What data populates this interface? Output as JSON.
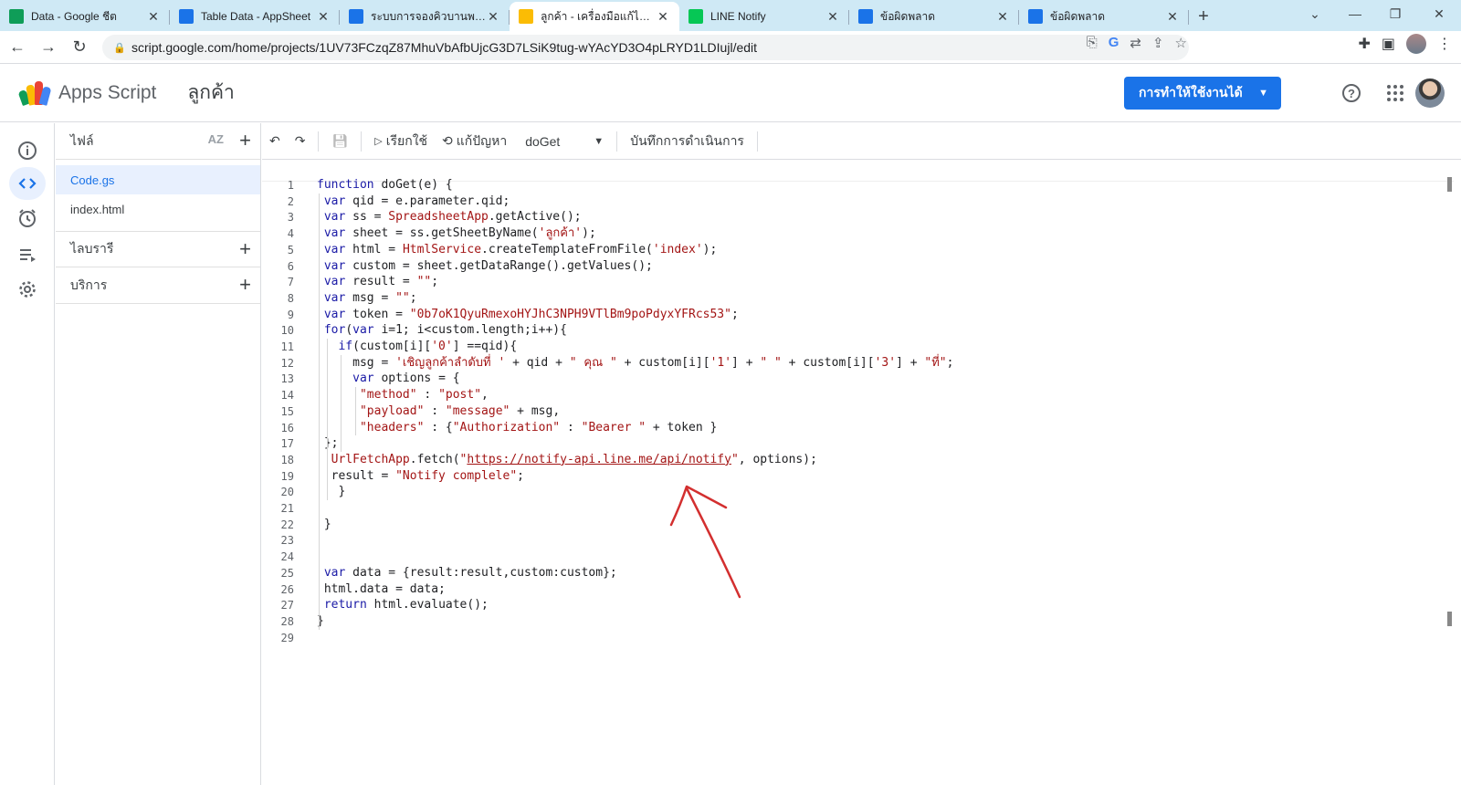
{
  "browser": {
    "tabs": [
      {
        "label": "Data - Google ชีต",
        "icon": "sheets-icon",
        "color": "#0f9d58",
        "active": false
      },
      {
        "label": "Table Data - AppSheet",
        "icon": "appsheet-icon",
        "color": "#1a73e8",
        "active": false
      },
      {
        "label": "ระบบการจองคิวบานพาหนะ",
        "icon": "appsheet-icon",
        "color": "#1a73e8",
        "active": false
      },
      {
        "label": "ลูกค้า - เครื่องมือแก้ไขโครงการ",
        "icon": "apps-script-icon",
        "color": "#fbbc04",
        "active": true
      },
      {
        "label": "LINE Notify",
        "icon": "line-icon",
        "color": "#06c755",
        "active": false
      },
      {
        "label": "ข้อผิดพลาด",
        "icon": "arrow-icon",
        "color": "#1a73e8",
        "active": false
      },
      {
        "label": "ข้อผิดพลาด",
        "icon": "arrow-icon",
        "color": "#1a73e8",
        "active": false
      }
    ],
    "url": "script.google.com/home/projects/1UV73FCzqZ87MhuVbAfbUjcG3D7LSiK9tug-wYAcYD3O4pLRYD1LDIujl/edit"
  },
  "app": {
    "name": "Apps Script",
    "project_title": "ลูกค้า",
    "deploy_label": "การทำให้ใช้งานได้"
  },
  "files_panel": {
    "files_header": "ไฟล์",
    "sort_label": "AZ",
    "files": [
      "Code.gs",
      "index.html"
    ],
    "libraries_header": "ไลบรารี",
    "services_header": "บริการ"
  },
  "editor_toolbar": {
    "run_label": "เรียกใช้",
    "debug_label": "แก้ปัญหา",
    "function_name": "doGet",
    "log_label": "บันทึกการดำเนินการ"
  },
  "code": {
    "line_numbers": [
      "1",
      "2",
      "3",
      "4",
      "5",
      "6",
      "7",
      "8",
      "9",
      "10",
      "11",
      "12",
      "13",
      "14",
      "15",
      "16",
      "17",
      "18",
      "19",
      "20",
      "21",
      "22",
      "23",
      "24",
      "25",
      "26",
      "27",
      "28",
      "29"
    ],
    "lines": [
      "function doGet(e) {",
      " var qid = e.parameter.qid;",
      " var ss = SpreadsheetApp.getActive();",
      " var sheet = ss.getSheetByName('ลูกค้า');",
      " var html = HtmlService.createTemplateFromFile('index');",
      " var custom = sheet.getDataRange().getValues();",
      " var result = \"\";",
      " var msg = \"\";",
      " var token = \"0b7oK1QyuRmexoHYJhC3NPH9VTlBm9poPdyxYFRcs53\";",
      " for(var i=1; i<custom.length;i++){",
      "   if(custom[i]['0'] ==qid){",
      "     msg = 'เชิญลูกค้าลำดับที่ ' + qid + \" คุณ \" + custom[i]['1'] + \" \" + custom[i]['3'] + \"ที่\";",
      "     var options = {",
      "      \"method\" : \"post\",",
      "      \"payload\" : \"message\" + msg,",
      "      \"headers\" : {\"Authorization\" : \"Bearer \" + token }",
      " };",
      "  UrlFetchApp.fetch(\"https://notify-api.line.me/api/notify\", options);",
      "  result = \"Notify complele\";",
      "   }",
      "",
      " }",
      "",
      "",
      " var data = {result:result,custom:custom};",
      " html.data = data;",
      " return html.evaluate();",
      "}",
      ""
    ]
  },
  "colors": {
    "accent": "#1a73e8",
    "tab_strip": "#cfe9f5",
    "annotation": "#d32f2f"
  }
}
